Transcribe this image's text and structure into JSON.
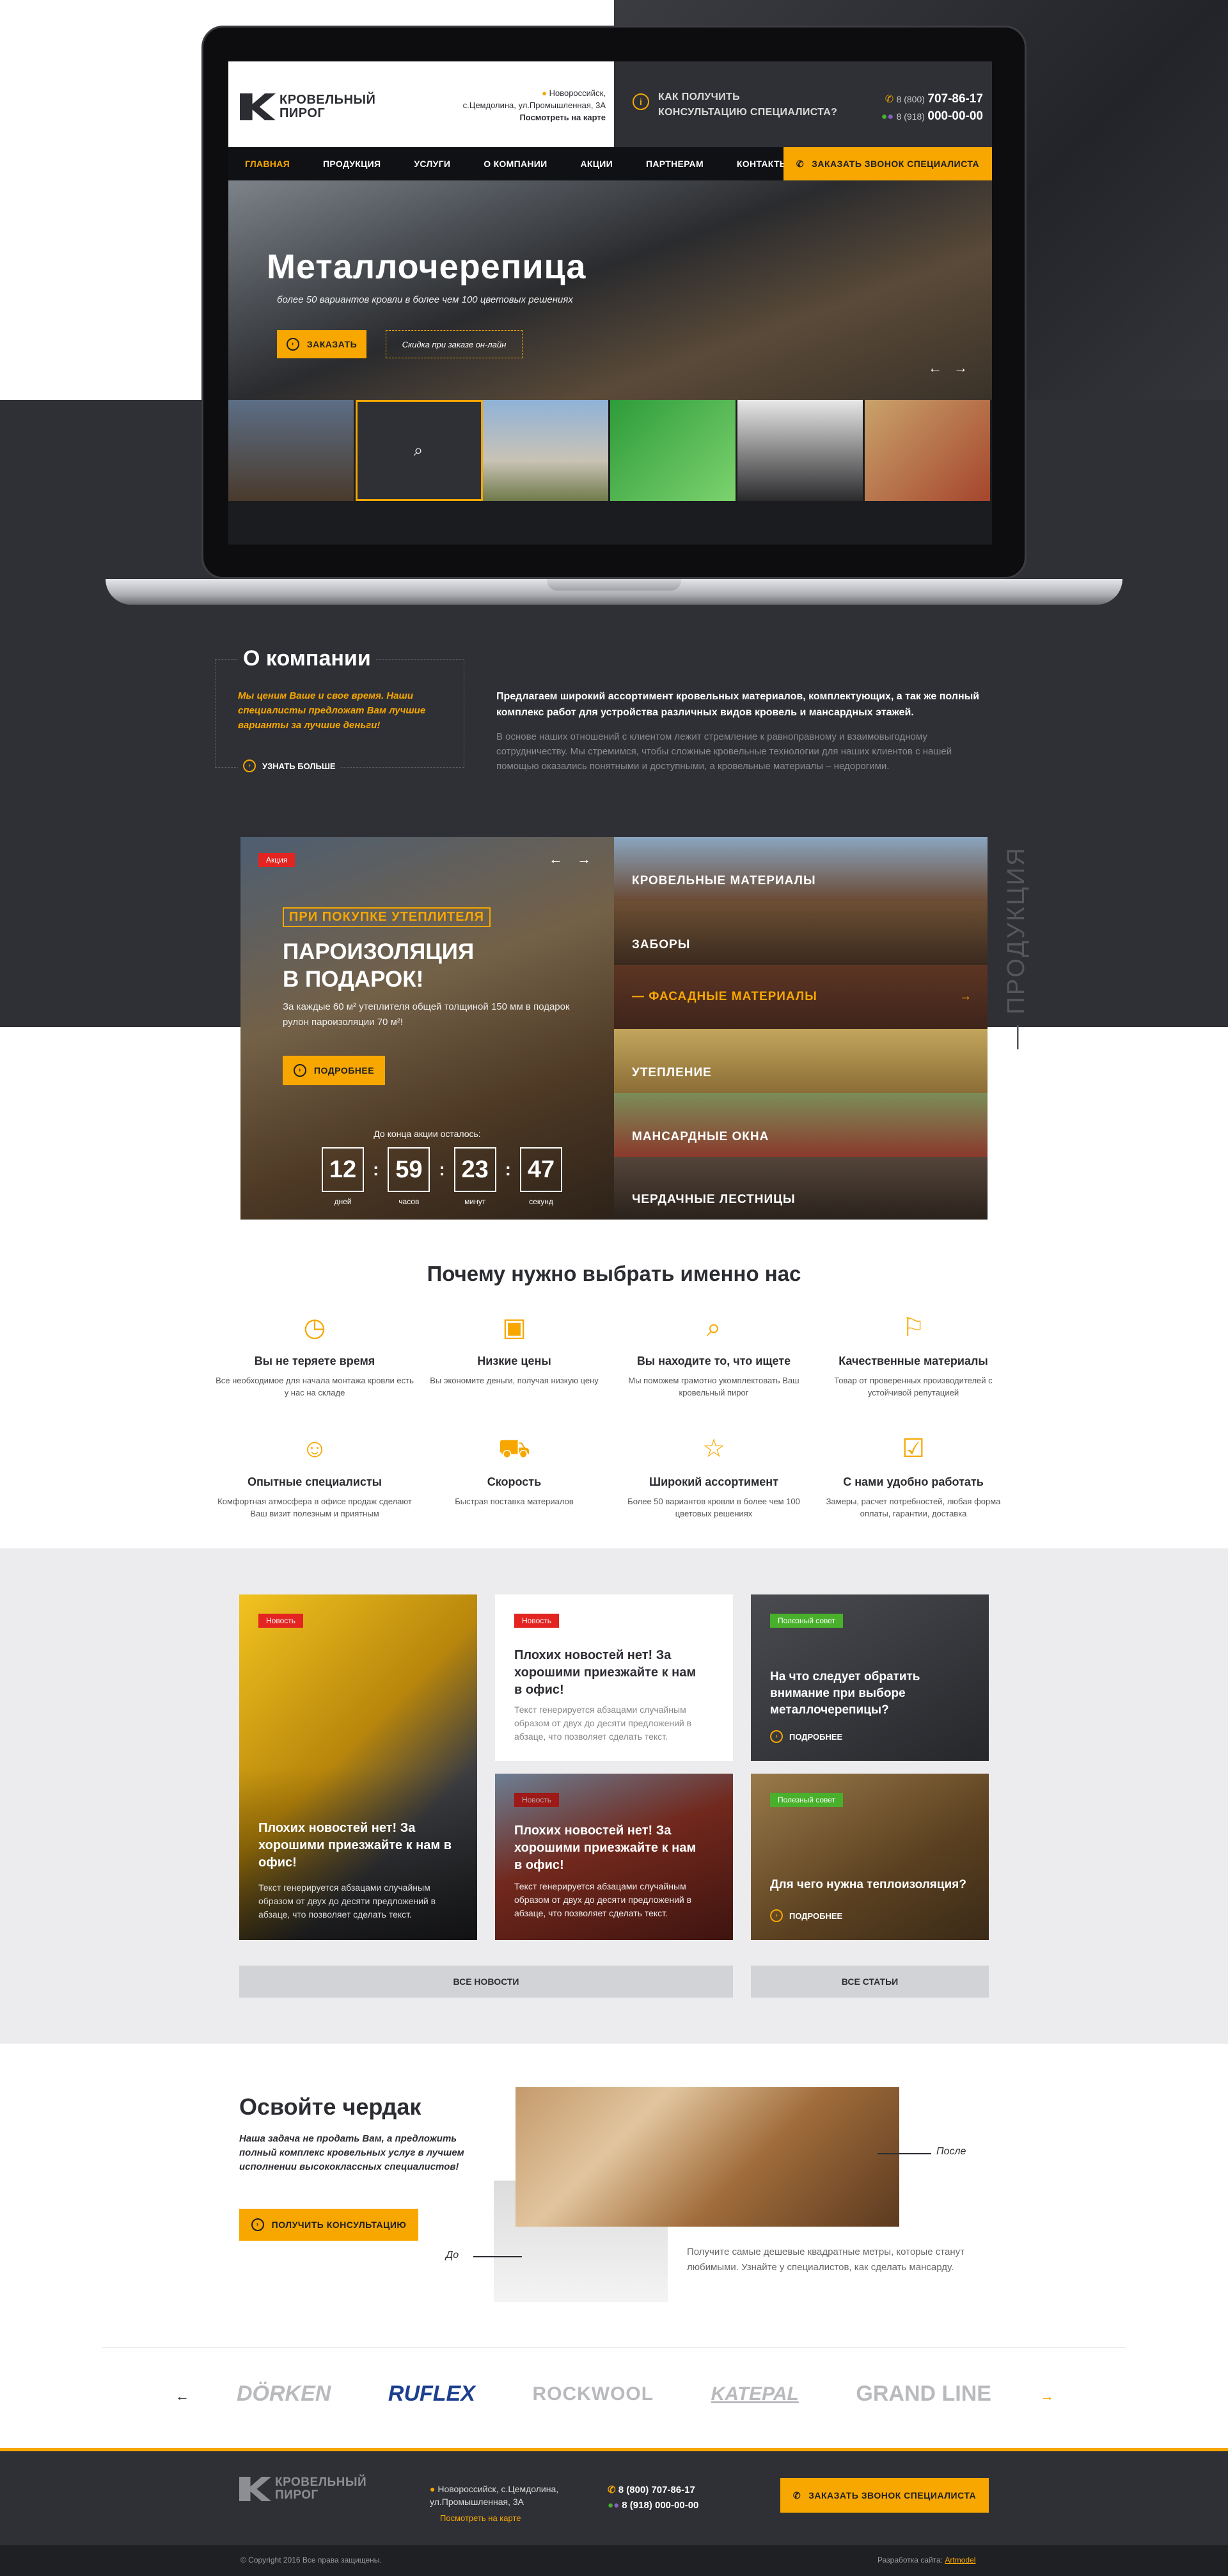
{
  "header": {
    "logo_line1": "КРОВЕЛЬНЫЙ",
    "logo_line2": "ПИРОГ",
    "address_line1": "Новороссийск,",
    "address_line2": "с.Цемдолина, ул.Промышленная, 3А",
    "map_link": "Посмотреть на карте",
    "consult_line1": "КАК ПОЛУЧИТЬ",
    "consult_line2": "КОНСУЛЬТАЦИЮ СПЕЦИАЛИСТА?",
    "phone1_prefix": "8 (800)",
    "phone1_main": "707-86-17",
    "phone2_prefix": "8 (918)",
    "phone2_main": "000-00-00"
  },
  "nav": {
    "items": [
      "ГЛАВНАЯ",
      "ПРОДУКЦИЯ",
      "УСЛУГИ",
      "О КОМПАНИИ",
      "АКЦИИ",
      "ПАРТНЕРАМ",
      "КОНТАКТЫ"
    ],
    "cta": "ЗАКАЗАТЬ ЗВОНОК СПЕЦИАЛИСТА"
  },
  "slider": {
    "title": "Металлочерепица",
    "subtitle": "более 50 вариантов кровли в более чем 100 цветовых решениях",
    "order_button": "ЗАКАЗАТЬ",
    "discount": "Скидка при заказе он-лайн"
  },
  "about": {
    "title": "О компании",
    "slogan": "Мы ценим Ваше и свое время. Наши специалисты предложат Вам лучшие варианты за лучшие деньги!",
    "more": "УЗНАТЬ БОЛЬШЕ",
    "lead": "Предлагаем широкий ассортимент кровельных материалов, комплектующих, а так же полный комплекс работ для устройства различных видов кровель и мансардных этажей.",
    "body": "В основе наших отношений с клиентом лежит стремление к равноправному и взаимовыгодному сотрудничеству. Мы стремимся, чтобы сложные кровельные технологии для наших клиентов с нашей помощью оказались понятными и доступными, а кровельные материалы – недорогими."
  },
  "promo": {
    "badge": "Акция",
    "kicker": "ПРИ ПОКУПКЕ УТЕПЛИТЕЛЯ",
    "title_line1": "ПАРОИЗОЛЯЦИЯ",
    "title_line2": "В ПОДАРОК!",
    "desc": "За каждые 60 м² утеплителя общей толщиной 150 мм в подарок рулон пароизоляции 70 м²!",
    "button": "ПОДРОБНЕЕ",
    "countdown_label": "До конца акции осталось:",
    "countdown": [
      {
        "value": "12",
        "unit": "дней"
      },
      {
        "value": "59",
        "unit": "часов"
      },
      {
        "value": "23",
        "unit": "минут"
      },
      {
        "value": "47",
        "unit": "секунд"
      }
    ]
  },
  "products": {
    "side_label": "ПРОДУКЦИЯ",
    "items": [
      "КРОВЕЛЬНЫЕ МАТЕРИАЛЫ",
      "ЗАБОРЫ",
      "ФАСАДНЫЕ МАТЕРИАЛЫ",
      "УТЕПЛЕНИЕ",
      "МАНСАРДНЫЕ ОКНА",
      "ЧЕРДАЧНЫЕ ЛЕСТНИЦЫ"
    ]
  },
  "why": {
    "title": "Почему нужно выбрать именно нас",
    "items": [
      {
        "title": "Вы не теряете время",
        "desc": "Все необходимое для начала монтажа кровли есть у нас на складе"
      },
      {
        "title": "Низкие цены",
        "desc": "Вы экономите деньги, получая низкую цену"
      },
      {
        "title": "Вы находите то, что ищете",
        "desc": "Мы поможем грамотно укомплектовать Ваш кровельный пирог"
      },
      {
        "title": "Качественные материалы",
        "desc": "Товар от проверенных производителей с устойчивой репутацией"
      },
      {
        "title": "Опытные специалисты",
        "desc": "Комфортная атмосфера в офисе продаж сделают Ваш визит полезным и приятным"
      },
      {
        "title": "Скорость",
        "desc": "Быстрая поставка материалов"
      },
      {
        "title": "Широкий ассортимент",
        "desc": "Более 50 вариантов кровли в более чем 100 цветовых решениях"
      },
      {
        "title": "С нами удобно работать",
        "desc": "Замеры, расчет потребностей, любая форма оплаты, гарантии, доставка"
      }
    ]
  },
  "news": {
    "badge_news": "Новость",
    "badge_tip": "Полезный совет",
    "card1_title": "Плохих новостей нет! За хорошими приезжайте к нам в офис!",
    "card1_text": "Текст генерируется абзацами случайным образом от двух до десяти предложений в абзаце, что позволяет сделать текст.",
    "card2_title": "Плохих новостей нет! За хорошими приезжайте к нам в офис!",
    "card2_text": "Текст генерируется абзацами случайным образом от двух до десяти предложений в абзаце, что позволяет сделать текст.",
    "card3_title": "Плохих новостей нет! За хорошими приезжайте к нам в офис!",
    "card3_text": "Текст генерируется абзацами случайным образом от двух до десяти предложений в абзаце, что позволяет сделать текст.",
    "tip1_title": "На что следует обратить внимание при выборе металлочерепицы?",
    "tip2_title": "Для чего нужна теплоизоляция?",
    "more": "ПОДРОБНЕЕ",
    "all_news": "ВСЕ НОВОСТИ",
    "all_articles": "ВСЕ СТАТЬИ"
  },
  "attic": {
    "title": "Освойте чердак",
    "desc": "Наша задача не продать Вам, а предложить полный комплекс кровельных услуг в лучшем исполнении высококлассных специалистов!",
    "button": "ПОЛУЧИТЬ КОНСУЛЬТАЦИЮ",
    "after": "После",
    "before": "До",
    "note": "Получите самые дешевые квадратные метры, которые станут любимыми. Узнайте у специалистов, как сделать мансарду."
  },
  "brands": [
    "DÖRKEN",
    "RUFLEX",
    "ROCKWOOL",
    "KATEPAL",
    "GRAND LINE"
  ],
  "footer": {
    "address": "Новороссийск, с.Цемдолина, ул.Промышленная, 3А",
    "map_link": "Посмотреть на карте",
    "phone1": "8 (800) 707-86-17",
    "phone2": "8 (918) 000-00-00",
    "cta": "ЗАКАЗАТЬ ЗВОНОК СПЕЦИАЛИСТА",
    "copyright": "© Copyright 2016 Все права защищены.",
    "dev_label": "Разработка сайта:",
    "dev_link": "Artmodel"
  },
  "colors": {
    "accent": "#f7a700",
    "dark": "#2f3035",
    "badge_red": "#e32421",
    "badge_green": "#48b02b"
  }
}
